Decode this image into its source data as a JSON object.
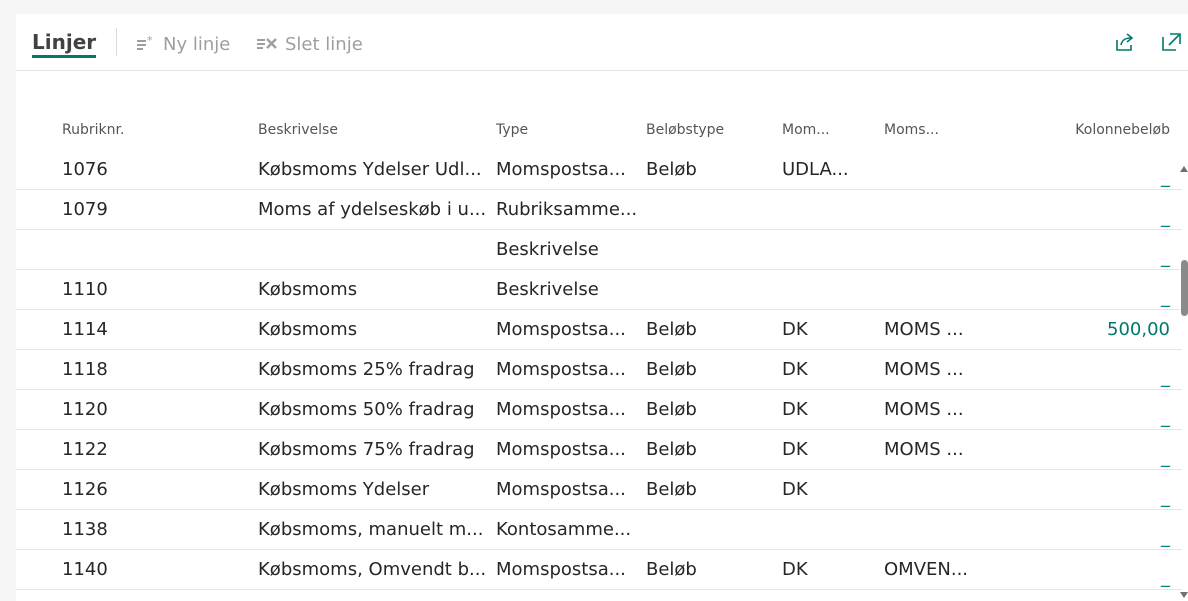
{
  "toolbar": {
    "title": "Linjer",
    "new_line_label": "Ny linje",
    "delete_line_label": "Slet linje",
    "icons": [
      "new-line-icon",
      "delete-line-icon",
      "share-icon",
      "expand-icon"
    ]
  },
  "colors": {
    "accent": "#00796b",
    "disabled": "#9e9e9e"
  },
  "columns": [
    "Rubriknr.",
    "Beskrivelse",
    "Type",
    "Beløbstype",
    "Mom...",
    "Moms...",
    "Kolonnebeløb"
  ],
  "rows": [
    {
      "rubriknr": "1076",
      "beskrivelse": "Købsmoms Ydelser Udl...",
      "type": "Momspostsa...",
      "beloebstype": "Beløb",
      "mom": "UDLA...",
      "moms": "",
      "kolonnebeloeb": "_"
    },
    {
      "rubriknr": "1079",
      "beskrivelse": "Moms af ydelseskøb i u...",
      "type": "Rubriksamme...",
      "beloebstype": "",
      "mom": "",
      "moms": "",
      "kolonnebeloeb": "_"
    },
    {
      "rubriknr": "",
      "beskrivelse": "",
      "type": "Beskrivelse",
      "beloebstype": "",
      "mom": "",
      "moms": "",
      "kolonnebeloeb": "_"
    },
    {
      "rubriknr": "1110",
      "beskrivelse": "Købsmoms",
      "type": "Beskrivelse",
      "beloebstype": "",
      "mom": "",
      "moms": "",
      "kolonnebeloeb": "_"
    },
    {
      "rubriknr": "1114",
      "beskrivelse": "Købsmoms",
      "type": "Momspostsa...",
      "beloebstype": "Beløb",
      "mom": "DK",
      "moms": "MOMS ...",
      "kolonnebeloeb": "500,00"
    },
    {
      "rubriknr": "1118",
      "beskrivelse": "Købsmoms 25% fradrag",
      "type": "Momspostsa...",
      "beloebstype": "Beløb",
      "mom": "DK",
      "moms": "MOMS ...",
      "kolonnebeloeb": "_"
    },
    {
      "rubriknr": "1120",
      "beskrivelse": "Købsmoms 50% fradrag",
      "type": "Momspostsa...",
      "beloebstype": "Beløb",
      "mom": "DK",
      "moms": "MOMS ...",
      "kolonnebeloeb": "_"
    },
    {
      "rubriknr": "1122",
      "beskrivelse": "Købsmoms 75% fradrag",
      "type": "Momspostsa...",
      "beloebstype": "Beløb",
      "mom": "DK",
      "moms": "MOMS ...",
      "kolonnebeloeb": "_"
    },
    {
      "rubriknr": "1126",
      "beskrivelse": "Købsmoms Ydelser",
      "type": "Momspostsa...",
      "beloebstype": "Beløb",
      "mom": "DK",
      "moms": "",
      "kolonnebeloeb": "_"
    },
    {
      "rubriknr": "1138",
      "beskrivelse": "Købsmoms, manuelt m...",
      "type": "Kontosamme...",
      "beloebstype": "",
      "mom": "",
      "moms": "",
      "kolonnebeloeb": "_"
    },
    {
      "rubriknr": "1140",
      "beskrivelse": "Købsmoms, Omvendt b...",
      "type": "Momspostsa...",
      "beloebstype": "Beløb",
      "mom": "DK",
      "moms": "OMVEN...",
      "kolonnebeloeb": "_"
    }
  ]
}
